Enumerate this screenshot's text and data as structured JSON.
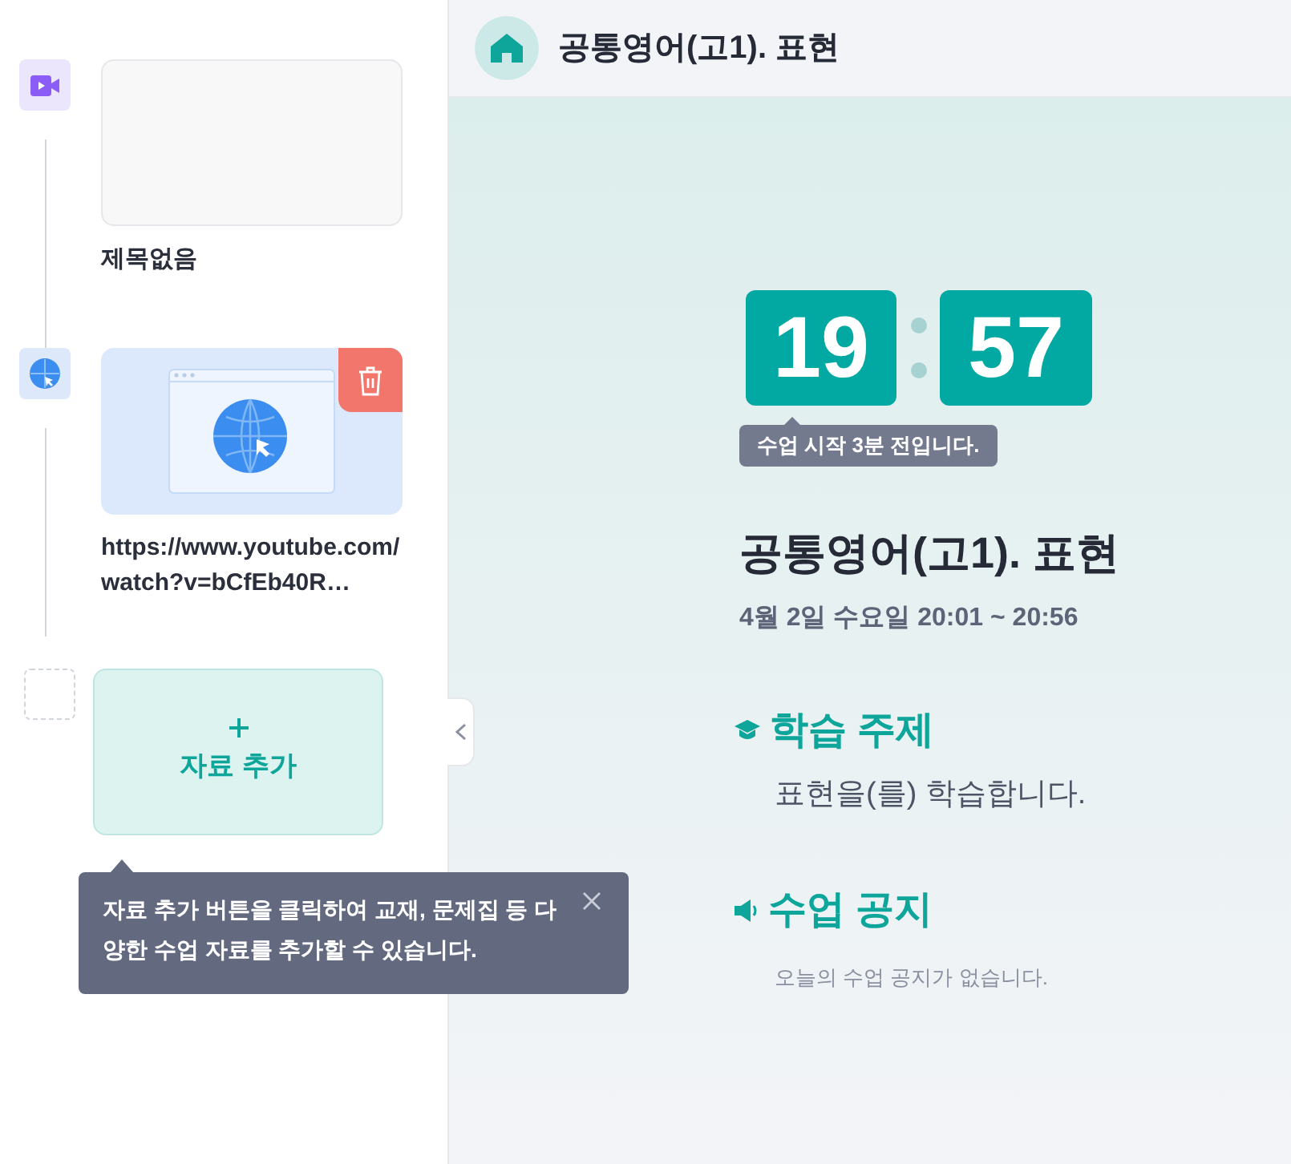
{
  "materials": [
    {
      "kind": "video",
      "title": "제목없음",
      "show_delete": false
    },
    {
      "kind": "link",
      "title": "https://www.youtube.com/watch?v=bCfEb40R…",
      "show_delete": true
    }
  ],
  "add_button": {
    "label": "자료 추가"
  },
  "hint": {
    "text": "자료 추가 버튼을 클릭하여 교재, 문제집 등 다양한 수업 자료를 추가할 수 있습니다."
  },
  "header": {
    "title": "공통영어(고1). 표현"
  },
  "clock": {
    "hours": "19",
    "minutes": "57",
    "badge": "수업 시작 3분 전입니다."
  },
  "lesson": {
    "title": "공통영어(고1). 표현",
    "schedule": "4월 2일 수요일 20:01 ~ 20:56"
  },
  "sections": [
    {
      "kind": "topic",
      "heading": "학습 주제",
      "body": "표현을(를) 학습합니다."
    },
    {
      "kind": "notice",
      "heading": "수업 공지",
      "body": "오늘의 수업 공지가 없습니다."
    }
  ]
}
